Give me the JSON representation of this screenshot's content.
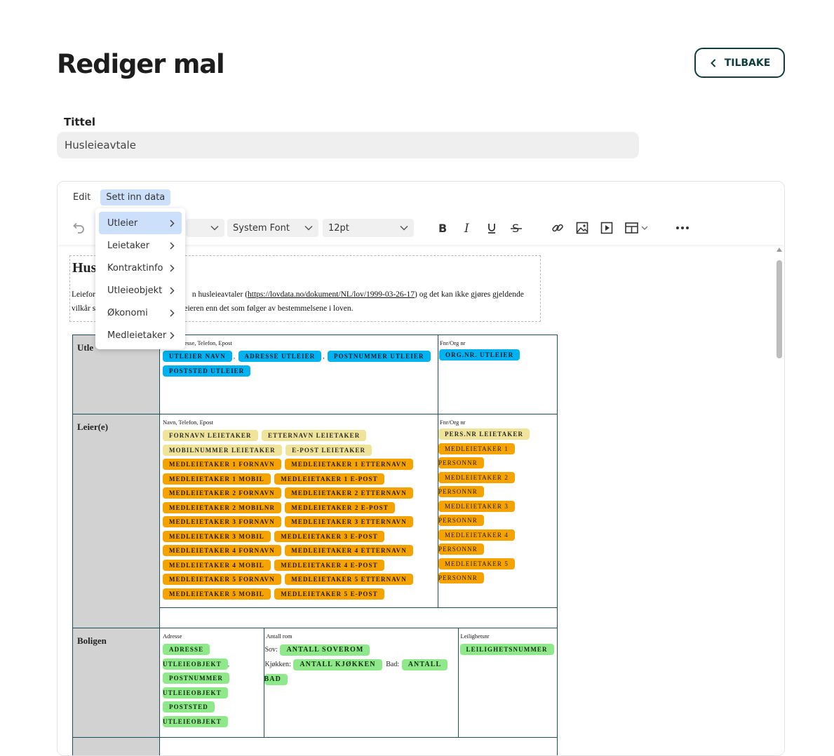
{
  "page": {
    "title": "Rediger mal",
    "back_label": "TILBAKE"
  },
  "form": {
    "title_label": "Tittel",
    "title_value": "Husleieavtale"
  },
  "editor": {
    "menubar": [
      "Edit",
      "Sett inn data"
    ],
    "font_family": "System Font",
    "font_size": "12pt"
  },
  "dropdown": {
    "items": [
      "Utleier",
      "Leietaker",
      "Kontraktinfo",
      "Utleieobjekt",
      "Økonomi",
      "Medleietaker"
    ],
    "active": "Utleier"
  },
  "document": {
    "heading": "Hus",
    "intro_line1_start": "Leiefor",
    "intro_line1_mid": "n husleieavtaler (",
    "intro_link": "https://lovdata.no/dokument/NL/lov/1999-03-26-17",
    "intro_line1_end": ") og det kan ikke gjøres gjeldende",
    "intro_line2_start": "vilkår s",
    "intro_line2_end": "leieren enn det som følger av bestemmelsene i loven.",
    "rows": {
      "utleier": {
        "head": "Utle",
        "sub_label": "dresse, Telefon, Epost",
        "tags": [
          "UTLEIER NAVN",
          "ADRESSE UTLEIER",
          "POSTNUMMER UTLEIER",
          "POSTSTED UTLEIER"
        ],
        "id_label": "Fnr/Org nr",
        "id_tag": "ORG.NR. UTLEIER"
      },
      "leier": {
        "head": "Leier(e)",
        "sub_label": "Navn, Telefon, Epost",
        "yellow_tags": [
          "FORNAVN LEIETAKER",
          "ETTERNAVN LEIETAKER",
          "MOBILNUMMER LEIETAKER",
          "E-POST LEIETAKER"
        ],
        "orange_tags": [
          "MEDLEIETAKER 1 FORNAVN",
          "MEDLEIETAKER 1 ETTERNAVN",
          "MEDLEIETAKER 1 MOBIL",
          "MEDLEIETAKER 1 E-POST",
          "MEDLEIETAKER 2 FORNAVN",
          "MEDLEIETAKER 2 ETTERNAVN",
          "MEDLEIETAKER 2 MOBILNR",
          "MEDLEIETAKER 2 E-POST",
          "MEDLEIETAKER 3 FORNAVN",
          "MEDLEIETAKER 3 ETTERNAVN",
          "MEDLEIETAKER 3 MOBIL",
          "MEDLEIETAKER 3 E-POST",
          "MEDLEIETAKER 4 FORNAVN",
          "MEDLEIETAKER 4 ETTERNAVN",
          "MEDLEIETAKER 4 MOBIL",
          "MEDLEIETAKER 4 E-POST",
          "MEDLEIETAKER 5 FORNAVN",
          "MEDLEIETAKER 5 ETTERNAVN",
          "MEDLEIETAKER 5 MOBIL",
          "MEDLEIETAKER 5 E-POST"
        ],
        "id_label": "Fnr/Org nr",
        "id_tag": "PERS.NR LEIETAKER",
        "id_orange": [
          [
            "MEDLEIETAKER 1",
            "PERSONNR"
          ],
          [
            "MEDLEIETAKER 2",
            "PERSONNR"
          ],
          [
            "MEDLEIETAKER 3",
            "PERSONNR"
          ],
          [
            "MEDLEIETAKER 4",
            "PERSONNR"
          ],
          [
            "MEDLEIETAKER 5",
            "PERSONNR"
          ]
        ]
      },
      "boligen": {
        "head": "Boligen",
        "adresse_label": "Adresse",
        "adresse_tags": [
          "ADRESSE",
          "UTLEIEOBJEKT",
          "POSTNUMMER",
          "UTLEIEOBJEKT",
          "POSTSTED",
          "UTLEIEOBJEKT"
        ],
        "rom_label": "Antall rom",
        "sov_label": "Sov:",
        "sov_tag": "ANTALL SOVEROM",
        "kjokken_label": "Kjøkken:",
        "kjokken_tag": "ANTALL KJØKKEN",
        "bad_label": "Bad:",
        "bad_tag_1": "ANTALL",
        "bad_tag_2": "BAD",
        "nr_label": "Leilighetsnr",
        "nr_tag": "LEILIGHETSNUMMER"
      }
    }
  },
  "colors": {
    "blue_tag": "#00b2f0",
    "yellow_tag": "#f0e49a",
    "orange_tag": "#f5a300",
    "green_tag": "#8fe88a",
    "menu_active": "#cde0fb",
    "back_border": "#0f3d3e"
  }
}
